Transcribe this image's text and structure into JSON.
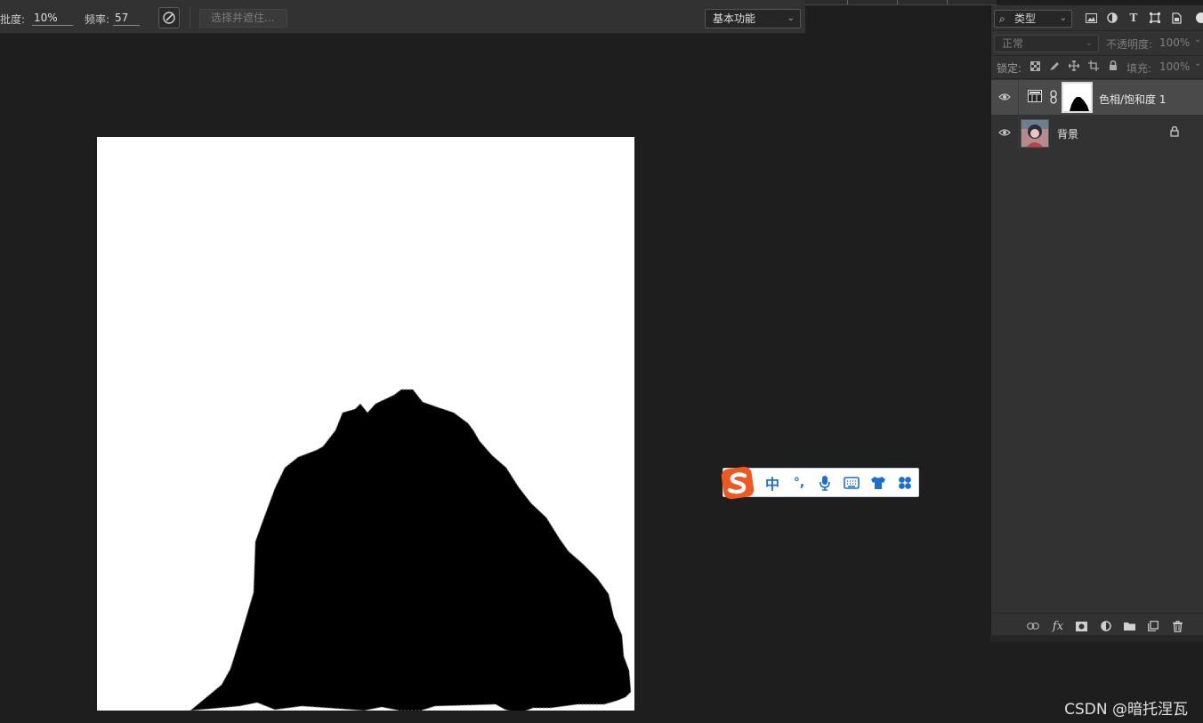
{
  "options_bar": {
    "flow_label": "批度:",
    "flow_value": "10%",
    "frequency_label": "频率:",
    "frequency_value": "57",
    "select_mask_label": "选择并遮住...",
    "workspace_value": "基本功能"
  },
  "ime_toolbar": {
    "mode_label": "中",
    "punct_label": "°,"
  },
  "layers_panel": {
    "filter_label": "类型",
    "blend_mode": "正常",
    "opacity_label": "不透明度:",
    "opacity_value": "100%",
    "lock_label": "锁定:",
    "fill_label": "填充:",
    "fill_value": "100%",
    "layers": [
      {
        "name": "色相/饱和度 1",
        "visible": true,
        "active": true,
        "type": "adjustment"
      },
      {
        "name": "背景",
        "visible": true,
        "active": false,
        "type": "background",
        "locked": true
      }
    ]
  },
  "colors": {
    "panel_bg": "#323232",
    "app_bg": "#1e1e1e",
    "active_layer": "#4a4a4a",
    "ime_blue": "#1a6fd6",
    "ime_logo": "#f0581f"
  },
  "watermark": "CSDN @暗托涅瓦"
}
